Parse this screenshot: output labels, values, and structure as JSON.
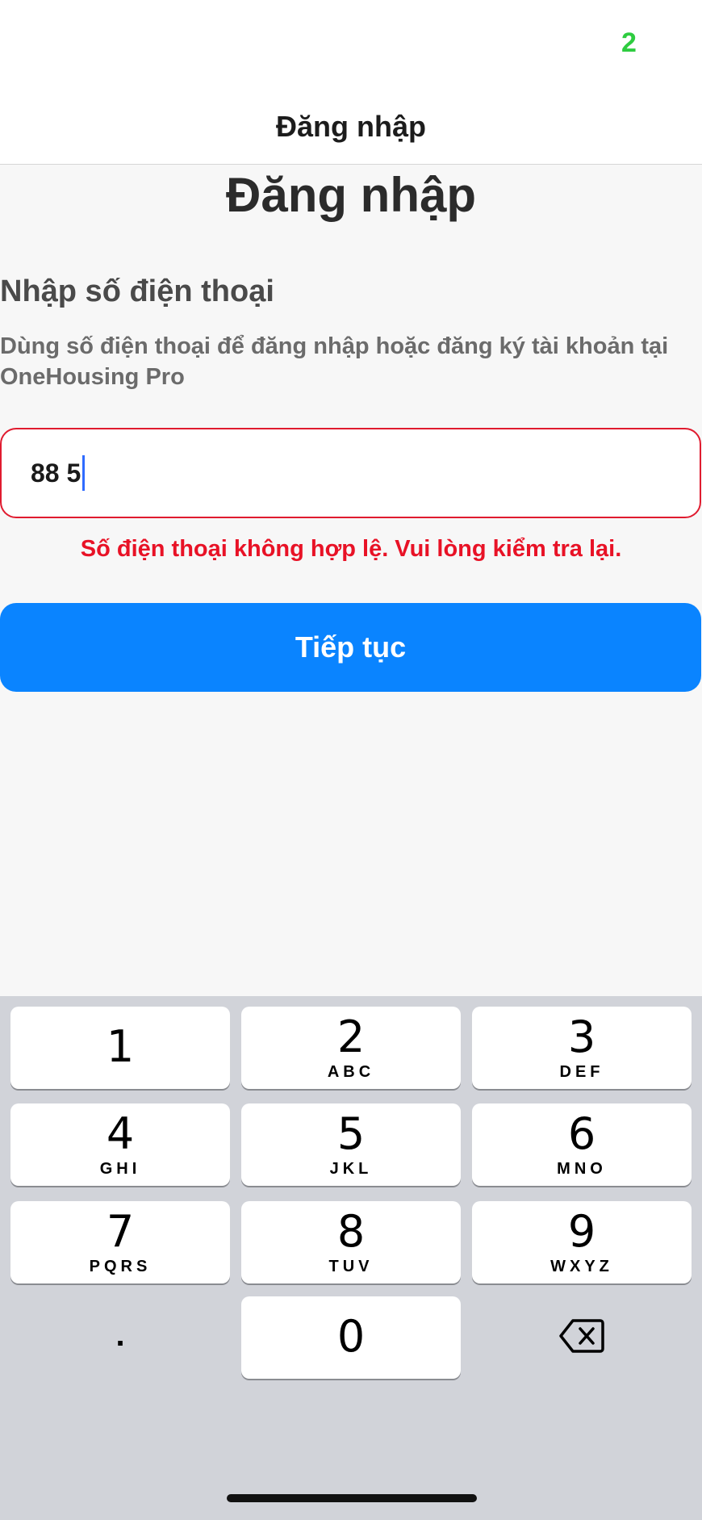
{
  "status_bar": {
    "indicator": "2"
  },
  "nav": {
    "title": "Đăng nhập"
  },
  "main": {
    "heading": "Đăng nhập",
    "section_title": "Nhập số điện thoại",
    "description": "Dùng số điện thoại để đăng nhập hoặc đăng ký tài khoản tại OneHousing Pro",
    "phone_value": "88 5",
    "error": "Số điện thoại không hợp lệ. Vui lòng kiểm tra lại.",
    "continue_label": "Tiếp tục"
  },
  "keyboard": {
    "keys": [
      {
        "digit": "1",
        "letters": ""
      },
      {
        "digit": "2",
        "letters": "ABC"
      },
      {
        "digit": "3",
        "letters": "DEF"
      },
      {
        "digit": "4",
        "letters": "GHI"
      },
      {
        "digit": "5",
        "letters": "JKL"
      },
      {
        "digit": "6",
        "letters": "MNO"
      },
      {
        "digit": "7",
        "letters": "PQRS"
      },
      {
        "digit": "8",
        "letters": "TUV"
      },
      {
        "digit": "9",
        "letters": "WXYZ"
      }
    ],
    "dot": ".",
    "zero": "0",
    "delete_icon": "backspace-icon"
  },
  "colors": {
    "accent": "#0a84ff",
    "error": "#e81226",
    "status_green": "#2ecc40"
  }
}
